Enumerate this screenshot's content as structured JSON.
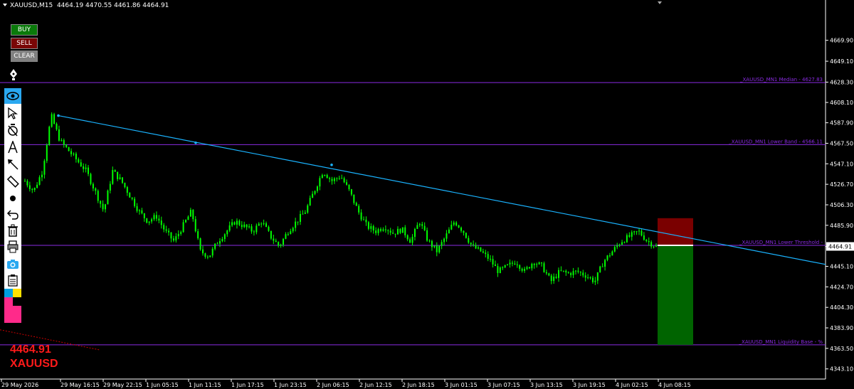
{
  "header": {
    "symbol_tf": "XAUUSD,M15",
    "ohlc": "4464.19 4470.55 4461.86 4464.91"
  },
  "buttons": {
    "buy": "BUY",
    "sell": "SELL",
    "clear": "CLEAR"
  },
  "toolbar_icons": [
    "pen-icon",
    "eye-icon",
    "cursor-icon",
    "crosshair-icon",
    "text-icon",
    "arrow-icon",
    "ruler-icon",
    "dot-icon",
    "undo-icon",
    "trash-icon",
    "printer-icon",
    "camera-icon",
    "clipboard-icon",
    "palette-icon"
  ],
  "price_display": {
    "price": "4464.91",
    "symbol": "XAUUSD"
  },
  "colors": {
    "bull": "#00ff00",
    "trendline": "#1ab3ff",
    "levels": "#8a2be2",
    "sl_box": "#7a0000",
    "tp_box": "#006400",
    "price_text": "#ff1a1a"
  },
  "chart_data": {
    "type": "candlestick",
    "symbol": "XAUUSD",
    "timeframe": "M15",
    "current_price": 4464.91,
    "ylim": [
      4333,
      4710
    ],
    "y_ticks": [
      "4669.90",
      "4649.10",
      "4628.30",
      "4608.10",
      "4587.90",
      "4567.50",
      "4547.10",
      "4526.70",
      "4506.30",
      "4485.90",
      "4464.91",
      "4445.10",
      "4424.70",
      "4404.30",
      "4383.90",
      "4363.50",
      "4343.10"
    ],
    "x_ticks": [
      "29 May 2026",
      "29 May 16:15",
      "29 May 22:15",
      "1 Jun 05:15",
      "1 Jun 11:15",
      "1 Jun 17:15",
      "1 Jun 23:15",
      "2 Jun 06:15",
      "2 Jun 12:15",
      "2 Jun 18:15",
      "3 Jun 01:15",
      "3 Jun 07:15",
      "3 Jun 13:15",
      "3 Jun 19:15",
      "4 Jun 02:15",
      "4 Jun 08:15"
    ],
    "close_path": [
      4530,
      4520,
      4540,
      4595,
      4570,
      4560,
      4550,
      4540,
      4520,
      4500,
      4540,
      4530,
      4515,
      4500,
      4490,
      4495,
      4480,
      4470,
      4485,
      4500,
      4460,
      4455,
      4470,
      4480,
      4490,
      4485,
      4480,
      4490,
      4475,
      4465,
      4480,
      4490,
      4500,
      4520,
      4540,
      4530,
      4535,
      4520,
      4500,
      4485,
      4480,
      4485,
      4478,
      4482,
      4470,
      4490,
      4470,
      4460,
      4475,
      4490,
      4480,
      4465,
      4460,
      4452,
      4440,
      4445,
      4450,
      4440,
      4450,
      4445,
      4430,
      4440,
      4438,
      4440,
      4436,
      4430,
      4450,
      4460,
      4470,
      4475,
      4480,
      4470,
      4465
    ],
    "horizontal_levels": [
      {
        "label": "XAUUSD_MN1 Median -  4627.83",
        "price": 4627.83
      },
      {
        "label": "XAUUSD_MN1 Lower Band -  4566.11",
        "price": 4566.11
      },
      {
        "label": "XAUUSD_MN1 Lower Threshold -",
        "price": 4466
      },
      {
        "label": "XAUUSD_MN1 Liquidity Base -  %",
        "price": 4367
      }
    ],
    "trendline": {
      "start": {
        "x": "29 May 16:15",
        "y": 4595
      },
      "end_price": 4447
    },
    "trade_boxes": {
      "stop_loss_top": 4493,
      "entry": 4466,
      "take_profit_bottom": 4367
    }
  }
}
